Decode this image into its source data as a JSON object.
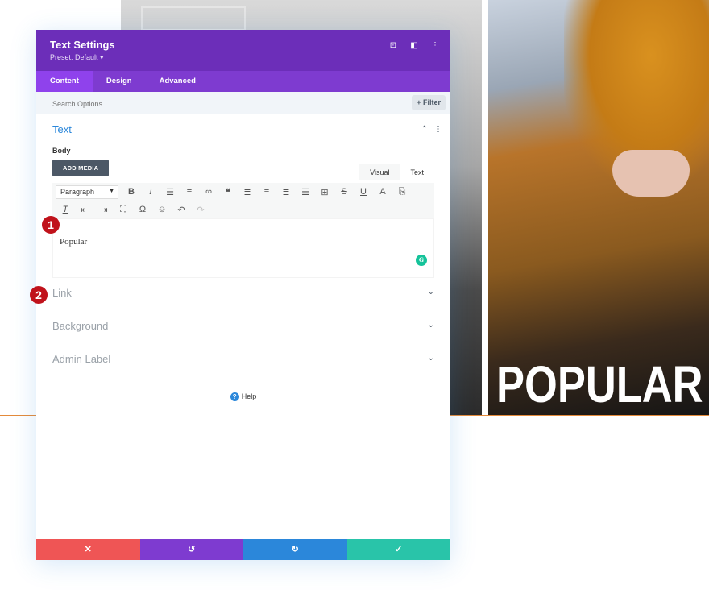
{
  "background": {
    "headline": "POPULAR"
  },
  "modal": {
    "title": "Text Settings",
    "preset": "Preset: Default ▾",
    "header_icons": [
      "screenshot-icon",
      "split-view-icon",
      "more-menu-icon"
    ],
    "tabs": [
      {
        "label": "Content",
        "active": true
      },
      {
        "label": "Design",
        "active": false
      },
      {
        "label": "Advanced",
        "active": false
      }
    ],
    "search": {
      "placeholder": "Search Options"
    },
    "filter_label": "+ Filter",
    "text_section": {
      "title": "Text",
      "body_label": "Body",
      "add_media": "ADD MEDIA",
      "editor_tabs": [
        "Visual",
        "Text"
      ],
      "format_select": "Paragraph",
      "content": "Popular"
    },
    "closed_toggles": [
      "Link",
      "Background",
      "Admin Label"
    ],
    "help_label": "Help",
    "footer": {
      "cancel": "✕",
      "undo": "↺",
      "redo": "↻",
      "save": "✓"
    },
    "colors": {
      "header": "#6c2eb9",
      "tabs": "#7e3bd0",
      "accent": "#2b87da",
      "cancel": "#ef5555",
      "save": "#29c4a9"
    }
  },
  "markers": [
    "1",
    "2"
  ]
}
